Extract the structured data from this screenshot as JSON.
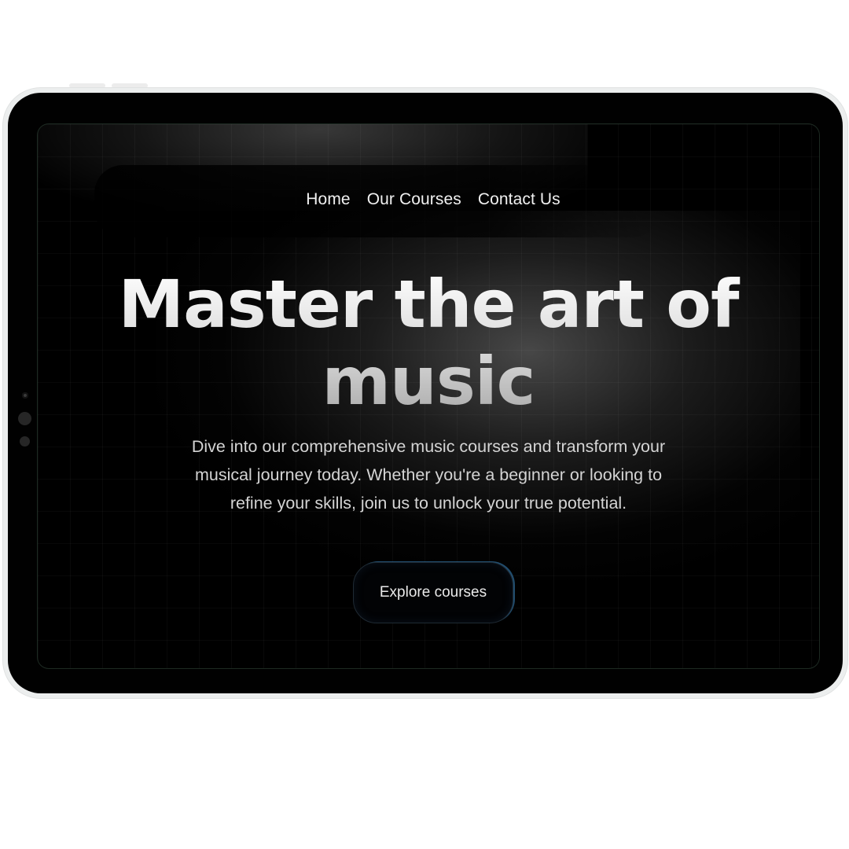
{
  "nav": {
    "items": [
      "Home",
      "Our Courses",
      "Contact Us"
    ]
  },
  "hero": {
    "title_line1": "Master the art of",
    "title_line2": "music",
    "description": "Dive into our comprehensive music courses and transform your musical journey today. Whether you're a beginner or looking to refine your skills, join us to unlock your true potential.",
    "cta_label": "Explore courses"
  },
  "colors": {
    "screen_background": "#000000",
    "bezel": "#010101",
    "frame": "#eceeee",
    "cta_accent": "#3c8cc8"
  }
}
